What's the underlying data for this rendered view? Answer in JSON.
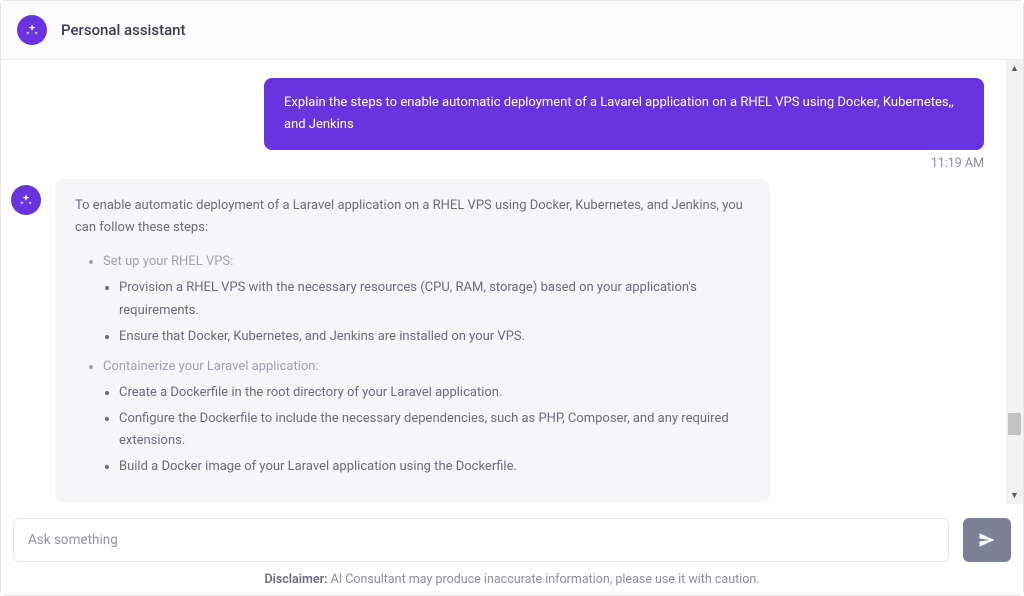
{
  "header": {
    "title": "Personal assistant",
    "icon": "sparkles-icon"
  },
  "conversation": {
    "user_message": "Explain the steps to enable automatic deployment of a Lavarel application on a RHEL VPS using Docker, Kubernetes,, and Jenkins",
    "user_time": "11:19 AM",
    "assistant_intro": "To enable automatic deployment of a Laravel application on a RHEL VPS using Docker, Kubernetes, and Jenkins, you can follow these steps:",
    "steps": {
      "step1_title": "Set up your RHEL VPS:",
      "step1_a": "Provision a RHEL VPS with the necessary resources (CPU, RAM, storage) based on your application's requirements.",
      "step1_b": "Ensure that Docker, Kubernetes, and Jenkins are installed on your VPS.",
      "step2_title": "Containerize your Laravel application:",
      "step2_a": "Create a Dockerfile in the root directory of your Laravel application.",
      "step2_b": "Configure the Dockerfile to include the necessary dependencies, such as PHP, Composer, and any required extensions.",
      "step2_c": "Build a Docker image of your Laravel application using the Dockerfile."
    }
  },
  "composer": {
    "placeholder": "Ask something"
  },
  "disclaimer": {
    "label": "Disclaimer:",
    "text": " AI Consultant may produce inaccurate information, please use it with caution."
  }
}
